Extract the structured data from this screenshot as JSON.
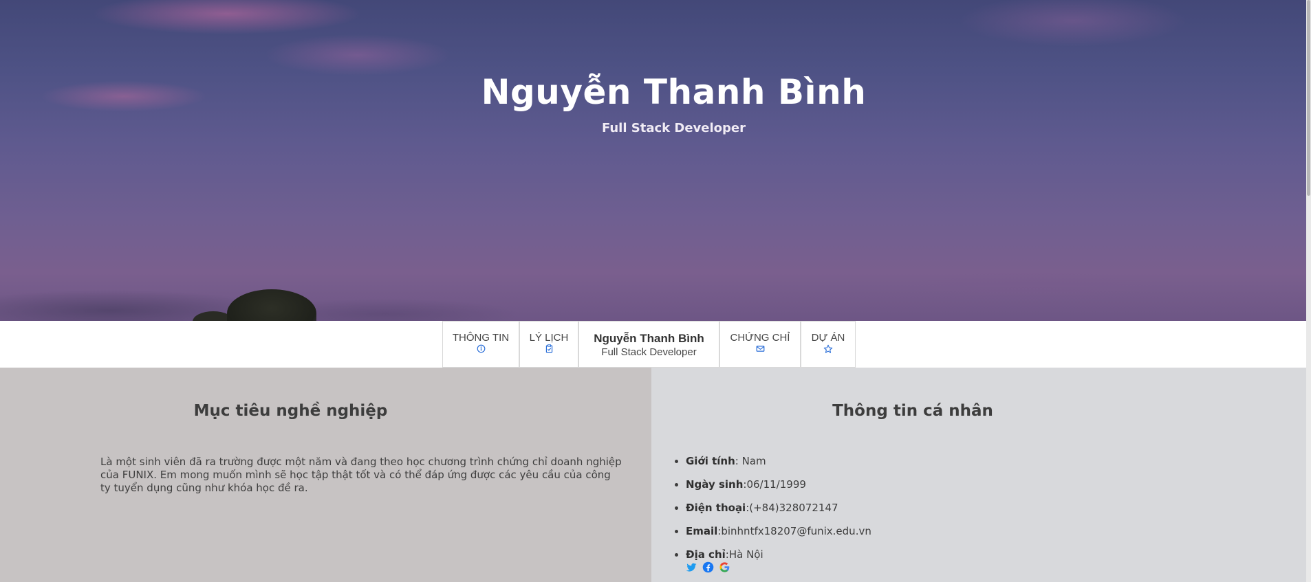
{
  "hero": {
    "name": "Nguyễn Thanh Bình",
    "role": "Full Stack Developer"
  },
  "nav": {
    "items_left": [
      {
        "label": "THÔNG TIN",
        "icon": "info-icon"
      },
      {
        "label": "LÝ LỊCH",
        "icon": "clipboard-check-icon"
      }
    ],
    "brand": {
      "name": "Nguyễn Thanh Bình",
      "role": "Full Stack Developer"
    },
    "items_right": [
      {
        "label": "CHỨNG CHỈ",
        "icon": "envelope-icon"
      },
      {
        "label": "DỰ ÁN",
        "icon": "star-icon"
      }
    ]
  },
  "objective": {
    "title": "Mục tiêu nghề nghiệp",
    "text": "Là một sinh viên đã ra trường được một năm và đang theo học chương trình chứng chỉ doanh nghiệp của FUNIX. Em mong muốn mình sẽ học tập thật tốt và có thể đáp ứng được các yêu cầu của công ty tuyển dụng cũng như khóa học đề ra."
  },
  "personal": {
    "title": "Thông tin cá nhân",
    "items": [
      {
        "label": "Giới tính",
        "sep": ": ",
        "value": "Nam"
      },
      {
        "label": "Ngày sinh",
        "sep": ":",
        "value": "06/11/1999"
      },
      {
        "label": "Điện thoại",
        "sep": ":",
        "value": "(+84)328072147"
      },
      {
        "label": "Email",
        "sep": ":",
        "value": "binhntfx18207@funix.edu.vn"
      },
      {
        "label": "Địa chỉ",
        "sep": ":",
        "value": "Hà Nội"
      }
    ],
    "socials": [
      "twitter-icon",
      "facebook-icon",
      "google-icon"
    ]
  },
  "colors": {
    "accent": "#2a6ed8",
    "left_panel": "#c7c3c3",
    "right_panel": "#d8d9dc"
  }
}
